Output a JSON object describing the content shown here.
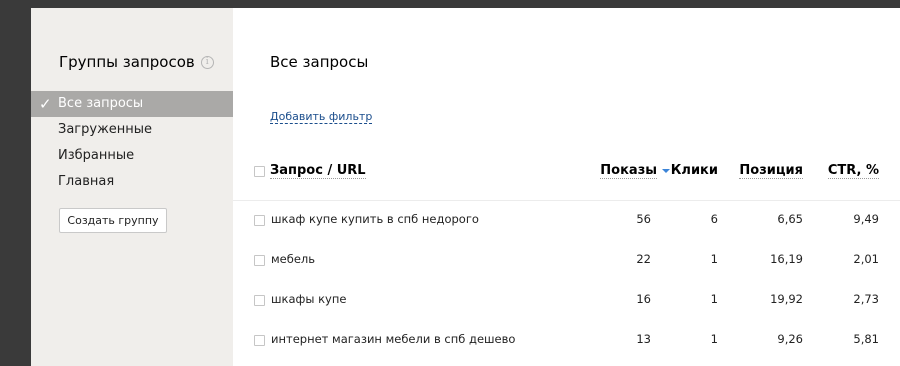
{
  "sidebar": {
    "title": "Группы запросов",
    "items": [
      {
        "label": "Все запросы"
      },
      {
        "label": "Загруженные"
      },
      {
        "label": "Избранные"
      },
      {
        "label": "Главная"
      }
    ],
    "create_button": "Создать группу"
  },
  "main": {
    "title": "Все запросы",
    "add_filter": "Добавить фильтр",
    "columns": {
      "query": "Запрос / URL",
      "shows": "Показы",
      "clicks": "Клики",
      "position": "Позиция",
      "ctr": "CTR, %"
    },
    "rows": [
      {
        "query": "шкаф купе купить в спб недорого",
        "shows": "56",
        "clicks": "6",
        "position": "6,65",
        "ctr": "9,49"
      },
      {
        "query": "мебель",
        "shows": "22",
        "clicks": "1",
        "position": "16,19",
        "ctr": "2,01"
      },
      {
        "query": "шкафы купе",
        "shows": "16",
        "clicks": "1",
        "position": "19,92",
        "ctr": "2,73"
      },
      {
        "query": "интернет магазин мебели в спб дешево",
        "shows": "13",
        "clicks": "1",
        "position": "9,26",
        "ctr": "5,81"
      }
    ]
  },
  "icons": {
    "info": "info-icon",
    "check": "check-icon",
    "sort": "sort-desc-icon"
  },
  "colors": {
    "sidebar_bg": "#f0eeeb",
    "active_item_bg": "#aaa9a7",
    "link": "#1a4d8c",
    "sort_arrow": "#3b84d8"
  }
}
